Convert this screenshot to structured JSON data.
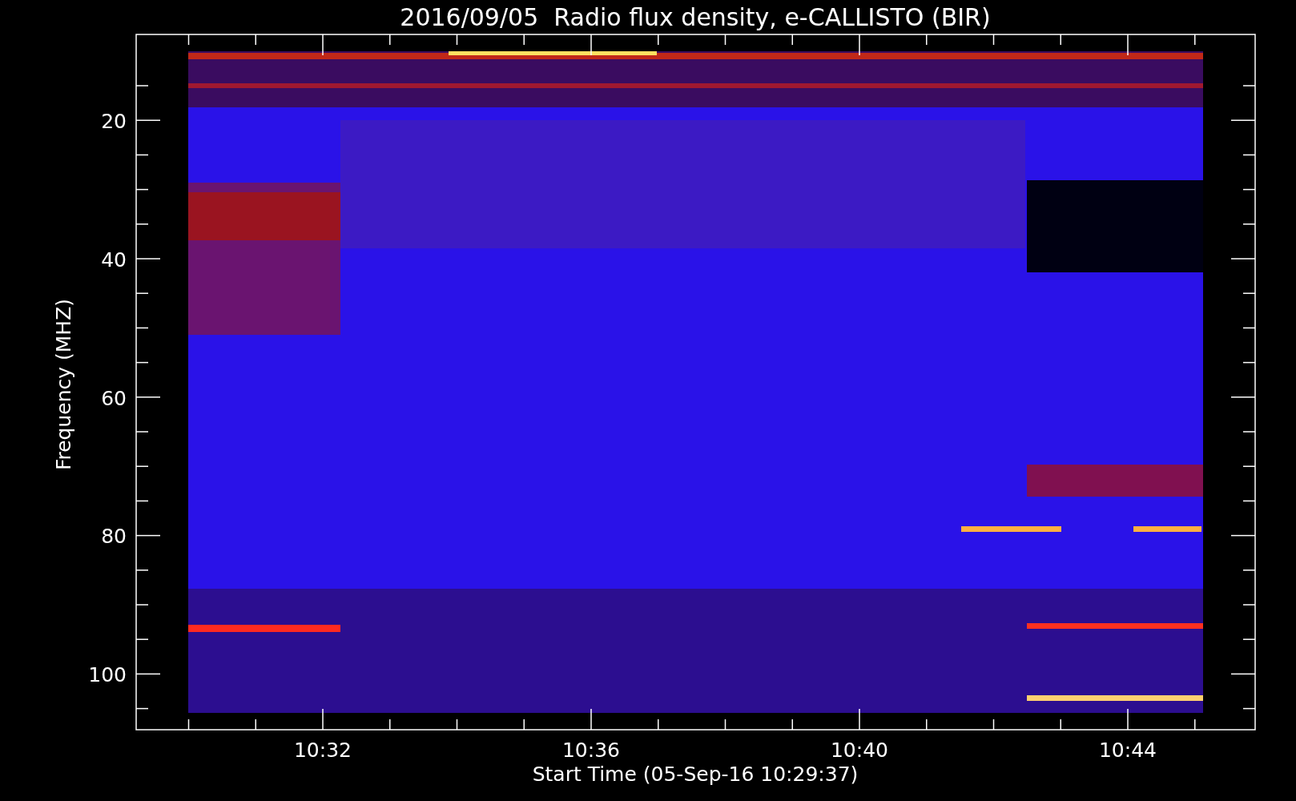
{
  "title": "2016/09/05  Radio flux density, e-CALLISTO (BIR)",
  "y_axis": {
    "label": "Frequency (MHZ)",
    "ticks": [
      "20",
      "40",
      "60",
      "80",
      "100"
    ]
  },
  "x_axis": {
    "label": "Start Time (05-Sep-16 10:29:37)",
    "ticks": [
      "10:32",
      "10:36",
      "10:40",
      "10:44"
    ]
  }
}
